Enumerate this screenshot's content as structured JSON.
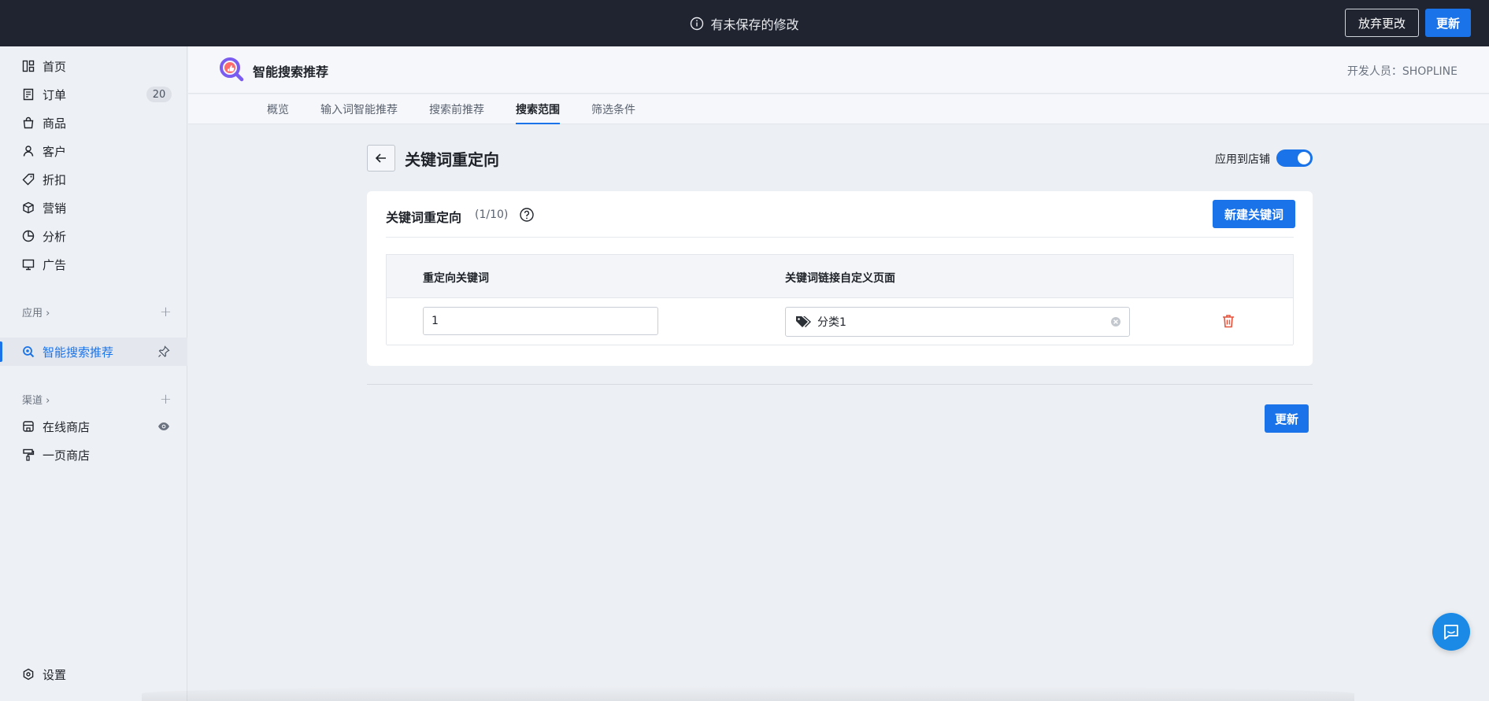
{
  "topbar": {
    "notice": "有未保存的修改",
    "discard_label": "放弃更改",
    "update_label": "更新"
  },
  "sidebar": {
    "items": [
      {
        "label": "首页",
        "icon": "home-icon"
      },
      {
        "label": "订单",
        "icon": "order-icon",
        "badge": "20"
      },
      {
        "label": "商品",
        "icon": "bag-icon"
      },
      {
        "label": "客户",
        "icon": "user-icon"
      },
      {
        "label": "折扣",
        "icon": "tag-icon"
      },
      {
        "label": "营销",
        "icon": "cube-icon"
      },
      {
        "label": "分析",
        "icon": "pie-icon"
      },
      {
        "label": "广告",
        "icon": "ad-icon"
      }
    ],
    "apps_section": "应用",
    "active_app": "智能搜索推荐",
    "channels_section": "渠道",
    "channels": [
      {
        "label": "在线商店",
        "icon": "store-icon"
      },
      {
        "label": "一页商店",
        "icon": "roller-icon"
      }
    ],
    "settings": "设置"
  },
  "app": {
    "title": "智能搜索推荐",
    "developer": "开发人员：SHOPLINE",
    "tabs": [
      "概览",
      "输入词智能推荐",
      "搜索前推荐",
      "搜索范围",
      "筛选条件"
    ],
    "active_tab": 3
  },
  "page": {
    "title": "关键词重定向",
    "apply_label": "应用到店铺",
    "apply_enabled": true,
    "card_title": "关键词重定向",
    "count": "(1/10)",
    "new_keyword_label": "新建关键词",
    "columns": [
      "重定向关键词",
      "关键词链接自定义页面"
    ],
    "rows": [
      {
        "keyword": "1",
        "link": "分类1"
      }
    ],
    "update_label": "更新"
  },
  "colors": {
    "primary": "#1a73e8",
    "topbar": "#1f2430",
    "danger": "#e5533d"
  }
}
